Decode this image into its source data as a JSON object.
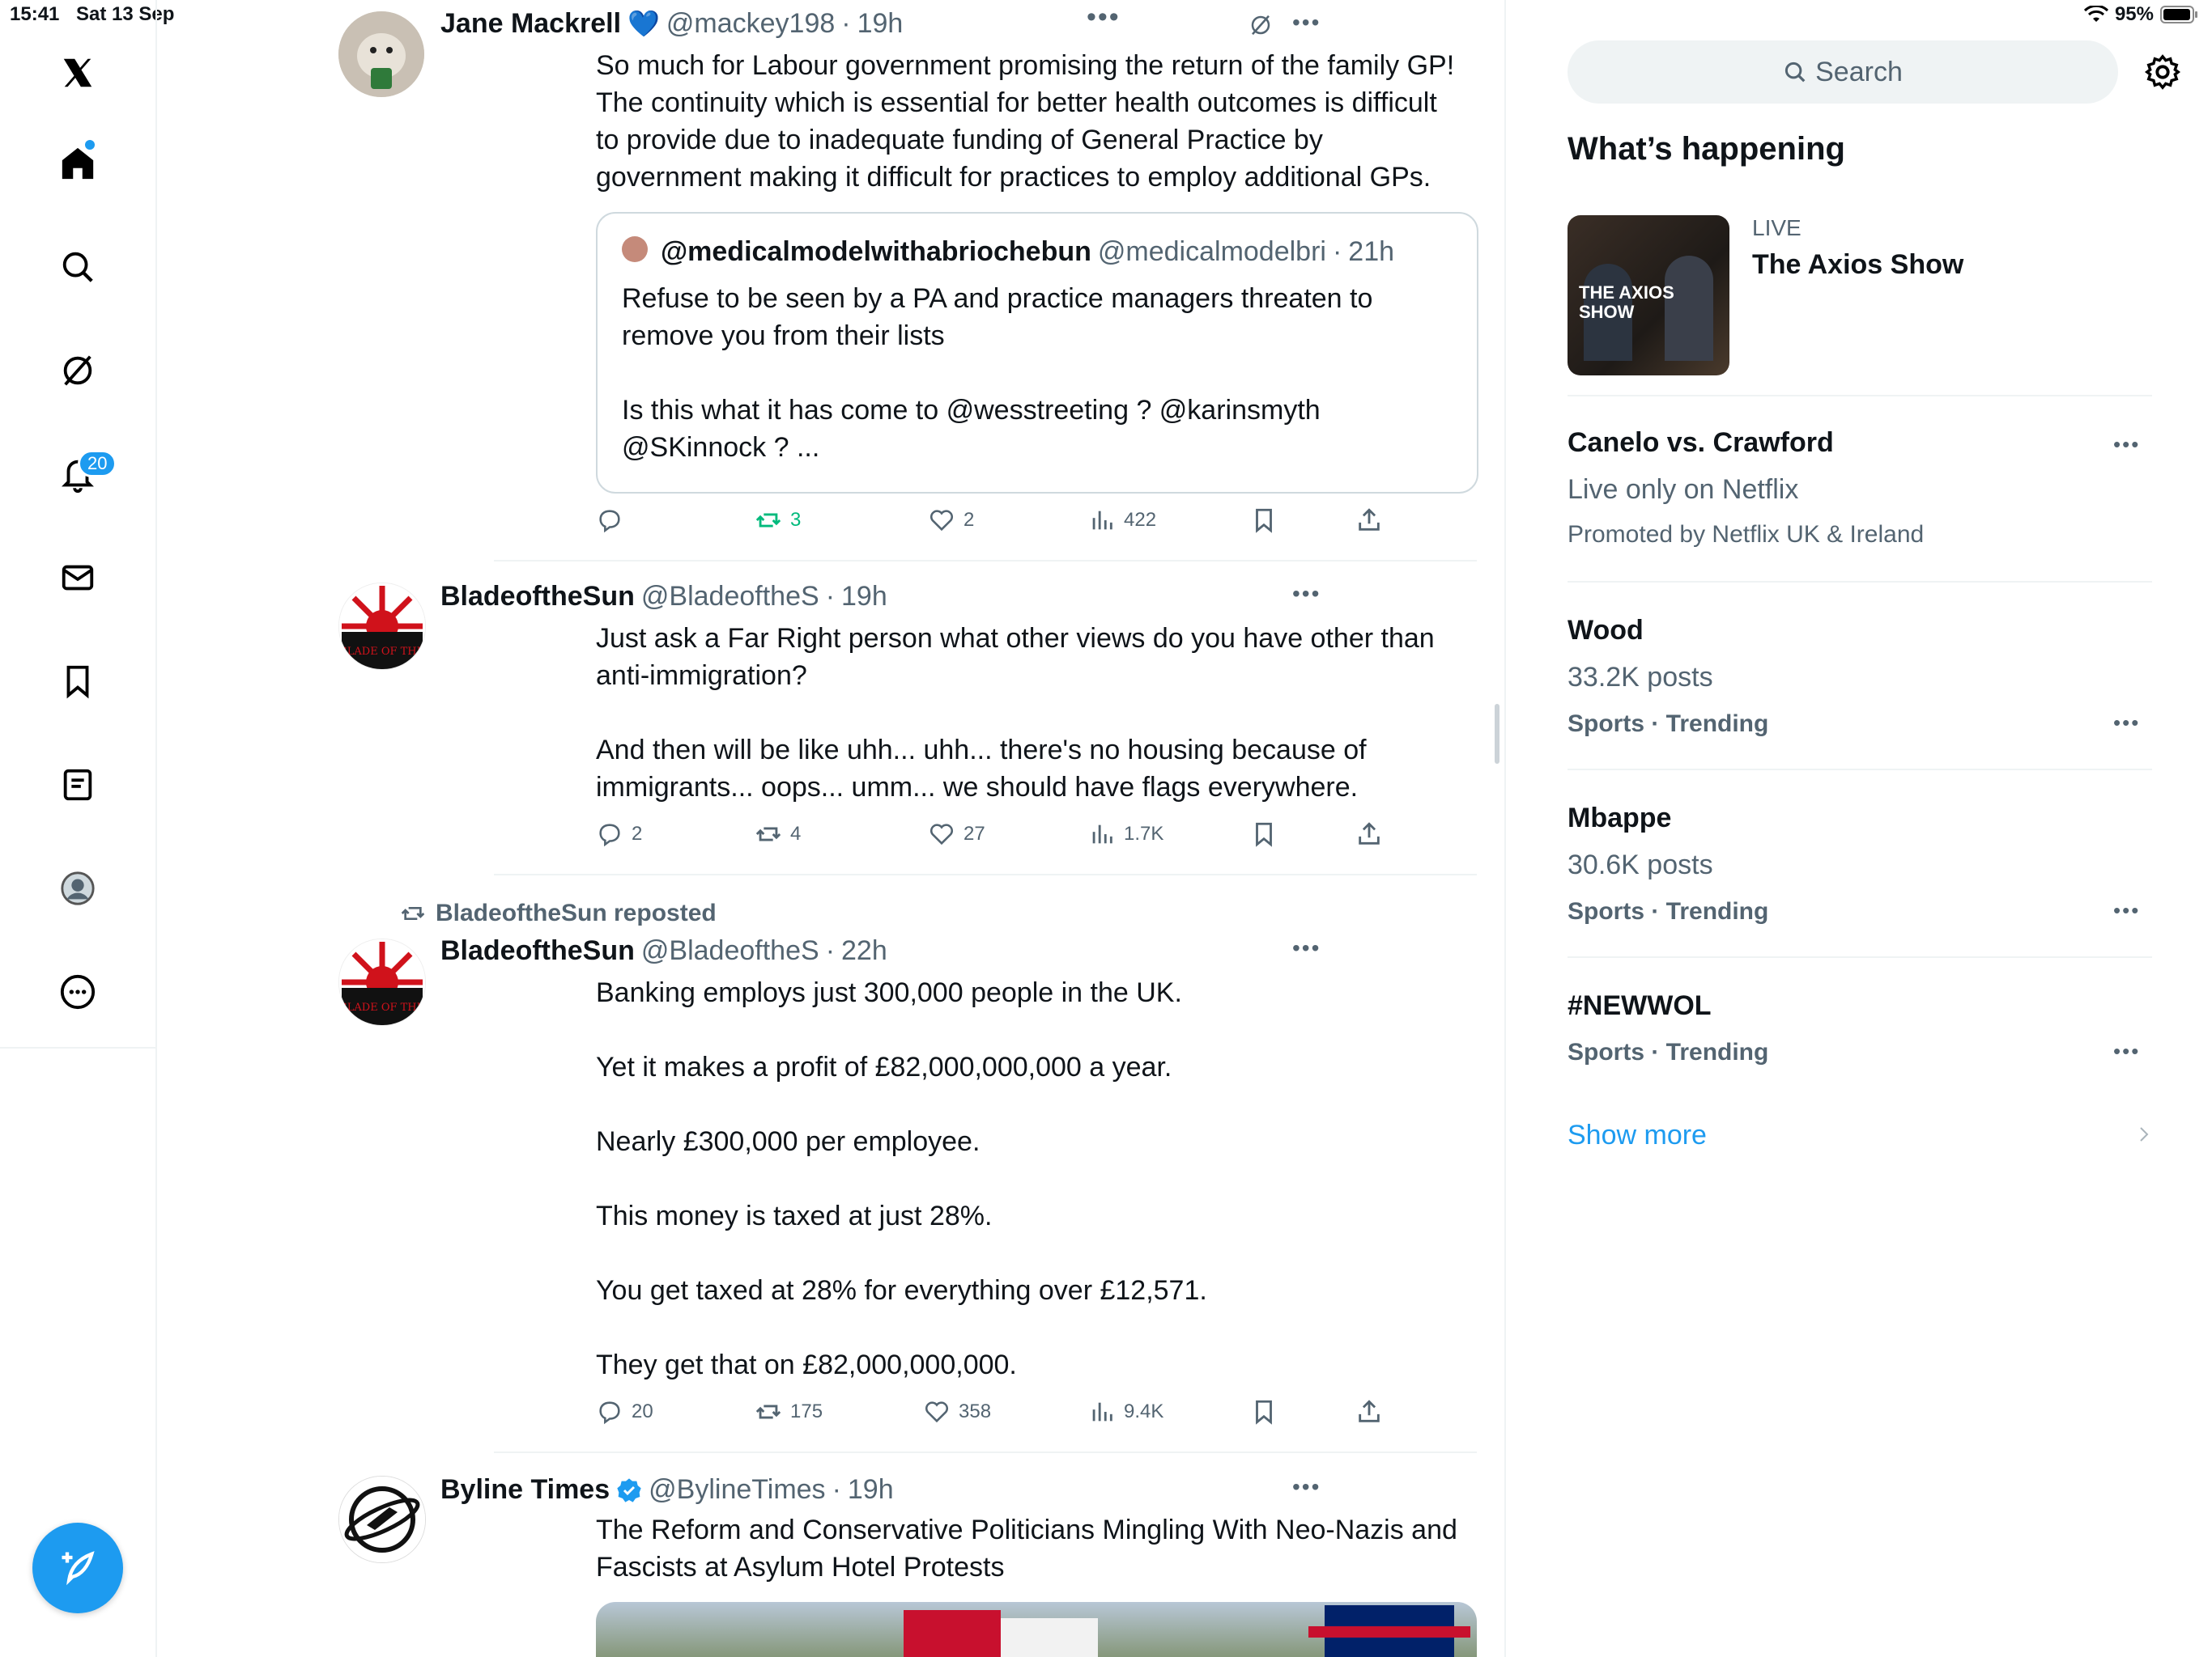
{
  "status_bar": {
    "time": "15:41",
    "date": "Sat 13 Sep",
    "battery": "95%"
  },
  "rail": {
    "notifications_badge": "20"
  },
  "feed": {
    "tweet1": {
      "name": "Jane Mackrell",
      "name_emoji": "💙",
      "handle": "@mackey198",
      "dot": "·",
      "time": "19h",
      "text_lines": [
        "So much for Labour government promising the return of the family GP!",
        "The continuity which is essential for better health outcomes is difficult",
        "to provide due to inadequate funding of General Practice by",
        "government making it difficult for practices to employ additional GPs."
      ],
      "quote": {
        "name": "@medicalmodelwithabriochebun",
        "handle": "@medicalmodelbri",
        "dot": "·",
        "time": "21h",
        "lines1": [
          "Refuse to be seen by a PA and practice managers threaten to",
          "remove you from their lists"
        ],
        "lines2": [
          "Is this what it has come to @wesstreeting ? @karinsmyth",
          "@SKinnock ? ..."
        ]
      },
      "reposts": "3",
      "likes": "2",
      "views": "422"
    },
    "tweet2": {
      "name": "BladeoftheSun",
      "handle": "@BladeoftheS",
      "dot": "·",
      "time": "19h",
      "lines1": [
        "Just ask a Far Right person what other views do you have other than",
        "anti-immigration?"
      ],
      "lines2": [
        "And then will be like uhh... uhh... there's no housing because of",
        "immigrants... oops... umm... we should have flags everywhere."
      ],
      "replies": "2",
      "reposts": "4",
      "likes": "27",
      "views": "1.7K"
    },
    "tweet3": {
      "reposted_by": "BladeoftheSun reposted",
      "name": "BladeoftheSun",
      "handle": "@BladeoftheS",
      "dot": "·",
      "time": "22h",
      "paragraphs": [
        "Banking employs just 300,000 people in the UK.",
        "Yet it makes a profit of £82,000,000,000 a year.",
        "Nearly £300,000 per employee.",
        "This money is taxed at just 28%.",
        "You get taxed at 28% for everything over £12,571.",
        "They get that on £82,000,000,000."
      ],
      "replies": "20",
      "reposts": "175",
      "likes": "358",
      "views": "9.4K"
    },
    "tweet4": {
      "name": "Byline Times",
      "handle": "@BylineTimes",
      "dot": "·",
      "time": "19h",
      "text_lines": [
        "The Reform and Conservative Politicians Mingling With Neo-Nazis and",
        "Fascists at Asylum Hotel Protests"
      ]
    },
    "avatar_text": "SLADE OF THE"
  },
  "sidebar": {
    "search_placeholder": "Search",
    "heading": "What’s happening",
    "live_label": "LIVE",
    "live_title": "The Axios Show",
    "thumb_text": "THE AXIOS SHOW",
    "trends": [
      {
        "title": "Canelo vs. Crawford",
        "sub": "Live only on Netflix",
        "cat": "Promoted by Netflix UK & Ireland"
      },
      {
        "title": "Wood",
        "sub": "33.2K posts",
        "cat": "Sports · Trending"
      },
      {
        "title": "Mbappe",
        "sub": "30.6K posts",
        "cat": "Sports · Trending"
      },
      {
        "title": "#NEWWOL",
        "cat": "Sports · Trending"
      }
    ],
    "show_more": "Show more"
  },
  "colors": {
    "accent": "#1d9bf0",
    "repost_active": "#00ba7c",
    "muted": "#536471"
  }
}
